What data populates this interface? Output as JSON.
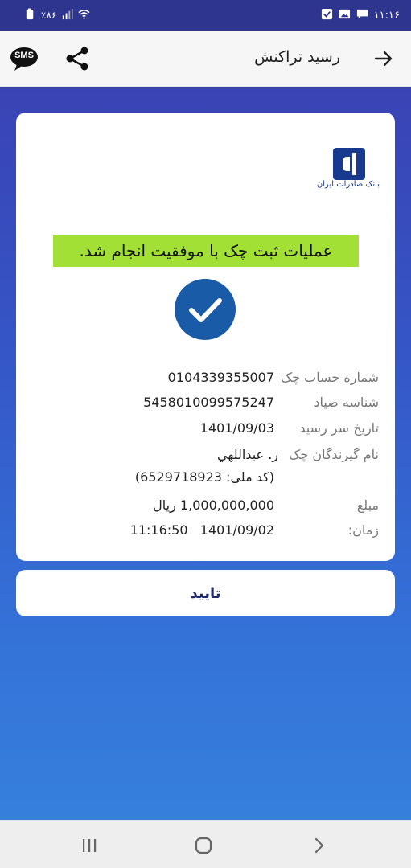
{
  "status_bar": {
    "time": "۱۱:۱۶",
    "battery": "٪۸۶",
    "icons": [
      "notification-check-icon",
      "gallery-icon",
      "message-icon",
      "wifi-icon",
      "signal-icon",
      "battery-icon"
    ]
  },
  "app_bar": {
    "title": "رسید تراکنش",
    "back_icon": "arrow-right-icon",
    "share_icon": "share-icon",
    "sms_label": "SMS"
  },
  "receipt": {
    "bank_name": "بانک صادرات ایران",
    "success_message": "عملیات ثبت چک با موفقیت انجام شد.",
    "fields": {
      "account_label": "شماره حساب چک",
      "account_value": "0104339355007",
      "sayad_label": "شناسه صیاد",
      "sayad_value": "5458010099575247",
      "due_date_label": "تاریخ سر رسید",
      "due_date_value": "1401/09/03",
      "receivers_label": "نام گیرندگان چک",
      "receiver_name": "ر. عبداللهي",
      "receiver_national_id": "(کد ملی: 6529718923)",
      "amount_label": "مبلغ",
      "amount_value": "1,000,000,000 ریال",
      "time_label": "زمان:",
      "time_value": "11:16:50   1401/09/02"
    }
  },
  "confirm_button": {
    "label": "تایید"
  },
  "nav_bar": {
    "icons": [
      "recent-apps-icon",
      "home-icon",
      "back-icon"
    ]
  },
  "colors": {
    "status_bar": "#2e358f",
    "gradient_top": "#3a43b4",
    "gradient_bottom": "#3680dc",
    "highlight": "#a3e036",
    "check_circle": "#1a5ba8",
    "bank_blue": "#173a8f"
  }
}
